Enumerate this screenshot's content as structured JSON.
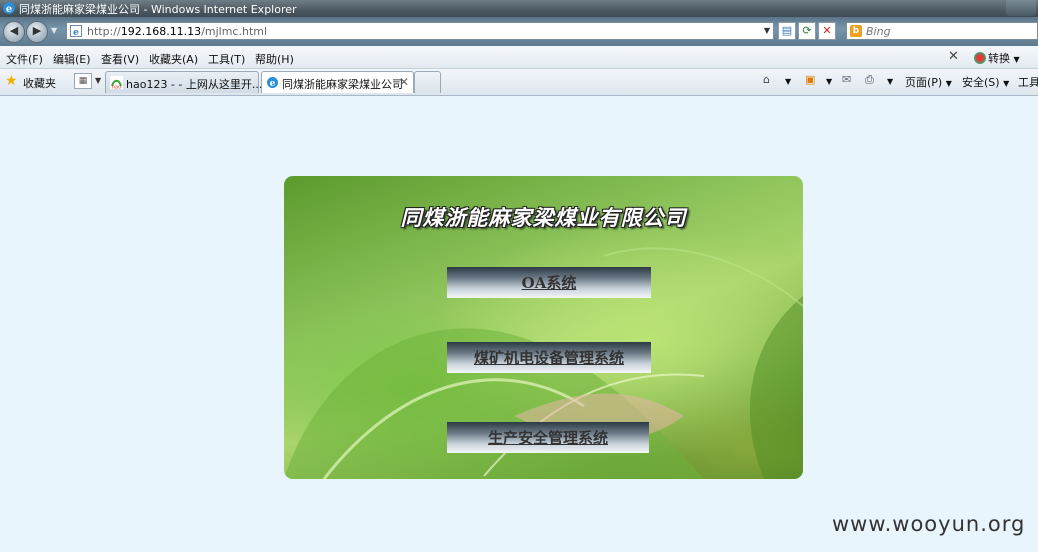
{
  "window": {
    "title": "同煤浙能麻家梁煤业公司 - Windows Internet Explorer"
  },
  "address": {
    "url_prefix": "http://",
    "url_host": "192.168.11.13",
    "url_path": "/mjlmc.html",
    "search_placeholder": "Bing"
  },
  "menu": {
    "items": [
      "文件(F)",
      "编辑(E)",
      "查看(V)",
      "收藏夹(A)",
      "工具(T)",
      "帮助(H)"
    ],
    "translate_label": "转换"
  },
  "favorites": {
    "label": "收藏夹",
    "tabs": [
      {
        "label": "hao123 - - 上网从这里开..."
      },
      {
        "label": "同煤浙能麻家梁煤业公司"
      }
    ],
    "commands": {
      "page": "页面(P)",
      "safety": "安全(S)",
      "tools": "工具"
    }
  },
  "page": {
    "company_name": "同煤浙能麻家梁煤业有限公司",
    "systems": [
      {
        "label": "OA系统"
      },
      {
        "label": "煤矿机电设备管理系统"
      },
      {
        "label": "生产安全管理系统"
      }
    ],
    "watermark": "www.wooyun.org"
  }
}
